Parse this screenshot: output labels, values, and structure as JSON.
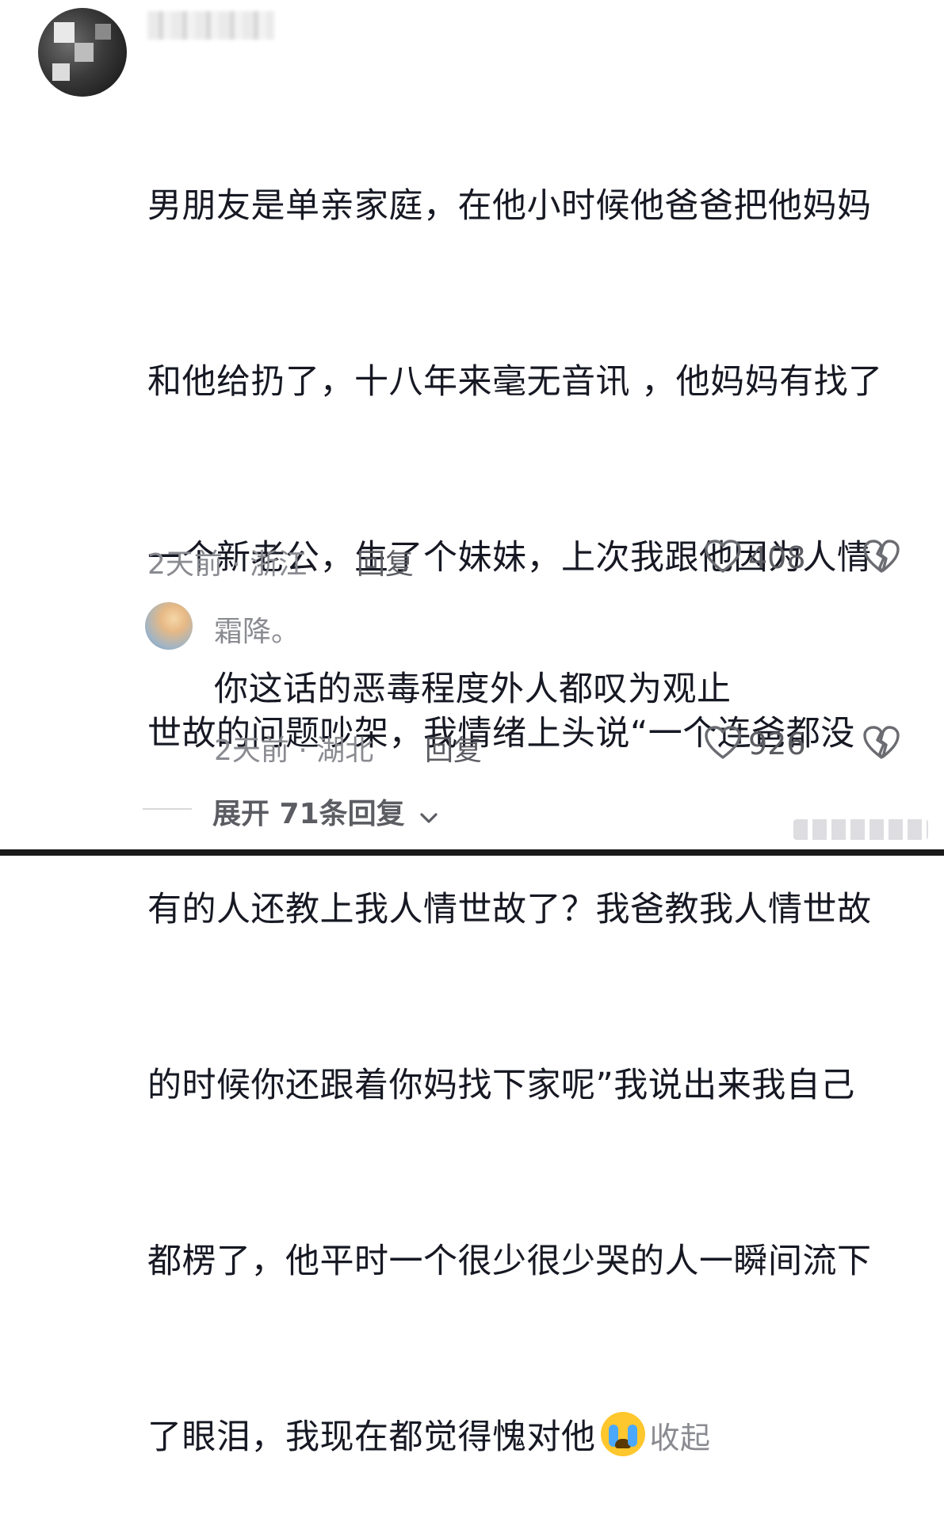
{
  "comment": {
    "lines": [
      "男朋友是单亲家庭，在他小时候他爸爸把他妈妈",
      "和他给扔了，十八年来毫无音讯 ，他妈妈有找了",
      "一个新老公，生了个妹妹，上次我跟他因为人情",
      "世故的问题吵架，我情绪上头说“一个连爸都没",
      "有的人还教上我人情世故了？我爸教我人情世故",
      "的时候你还跟着你妈找下家呢”我说出来我自己",
      "都楞了，他平时一个很少很少哭的人一瞬间流下"
    ],
    "last_line": "了眼泪，我现在都觉得愧对他",
    "emoji": "crying-face-icon",
    "collapse_label": "收起",
    "meta": "2天前 · 浙江",
    "reply_label": "回复",
    "like_count": "408"
  },
  "reply": {
    "author": "霜降。",
    "text": "你这话的恶毒程度外人都叹为观止",
    "meta": "2天前 · 湖北",
    "reply_label": "回复",
    "like_count": "926"
  },
  "expand_label": "展开 71条回复",
  "colors": {
    "text": "#161823",
    "meta": "#8a8b91",
    "emoji": "#ffc72e"
  }
}
